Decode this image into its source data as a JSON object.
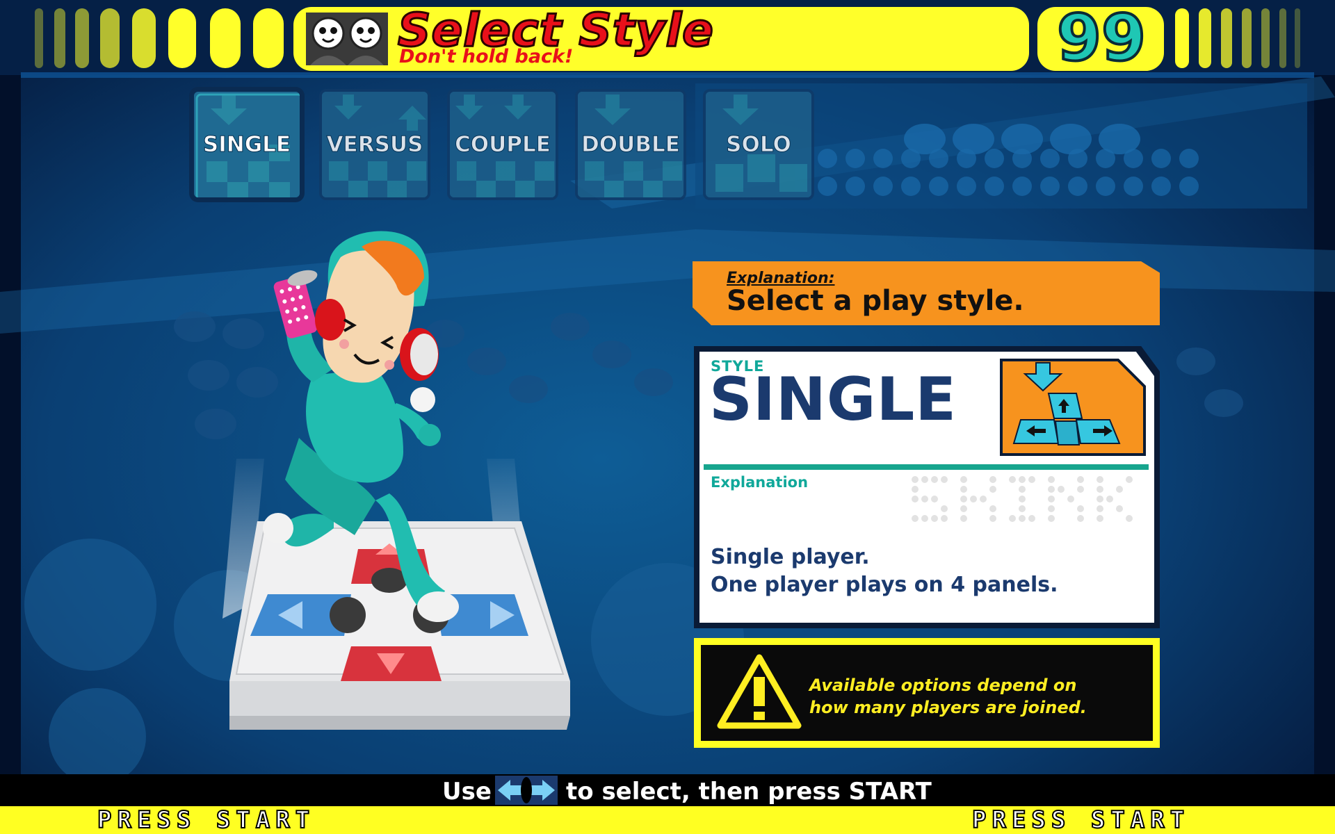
{
  "header": {
    "title": "Select Style",
    "subtitle": "Don't hold back!",
    "timer": "99"
  },
  "tabs": [
    {
      "label": "SINGLE",
      "selected": true
    },
    {
      "label": "VERSUS",
      "selected": false
    },
    {
      "label": "COUPLE",
      "selected": false
    },
    {
      "label": "DOUBLE",
      "selected": false
    },
    {
      "label": "SOLO",
      "selected": false
    }
  ],
  "explanation_banner": {
    "label": "Explanation:",
    "text": "Select a play style."
  },
  "style_card": {
    "style_label": "STYLE",
    "style_name": "SINGLE",
    "explanation_label": "Explanation",
    "description_line1": "Single player.",
    "description_line2": "One player plays on 4 panels."
  },
  "warning": {
    "line1": "Available options depend on",
    "line2": "how many players are joined."
  },
  "footer": {
    "instruction_prefix": "Use",
    "instruction_suffix": "to select, then press START",
    "press_start_left": "PRESS START",
    "press_start_right": "PRESS START"
  },
  "colors": {
    "accent_yellow": "#ffff2a",
    "title_red": "#e8101a",
    "timer_teal": "#1fc7b4",
    "banner_orange": "#f7931e",
    "navy_text": "#1b3a6e",
    "teal_label": "#10a89a",
    "background_blue": "#0b4f86"
  },
  "icons": [
    "player-faces-icon",
    "arrow-down-icon",
    "dance-pad-icon",
    "warning-icon",
    "panel-select-icon"
  ]
}
